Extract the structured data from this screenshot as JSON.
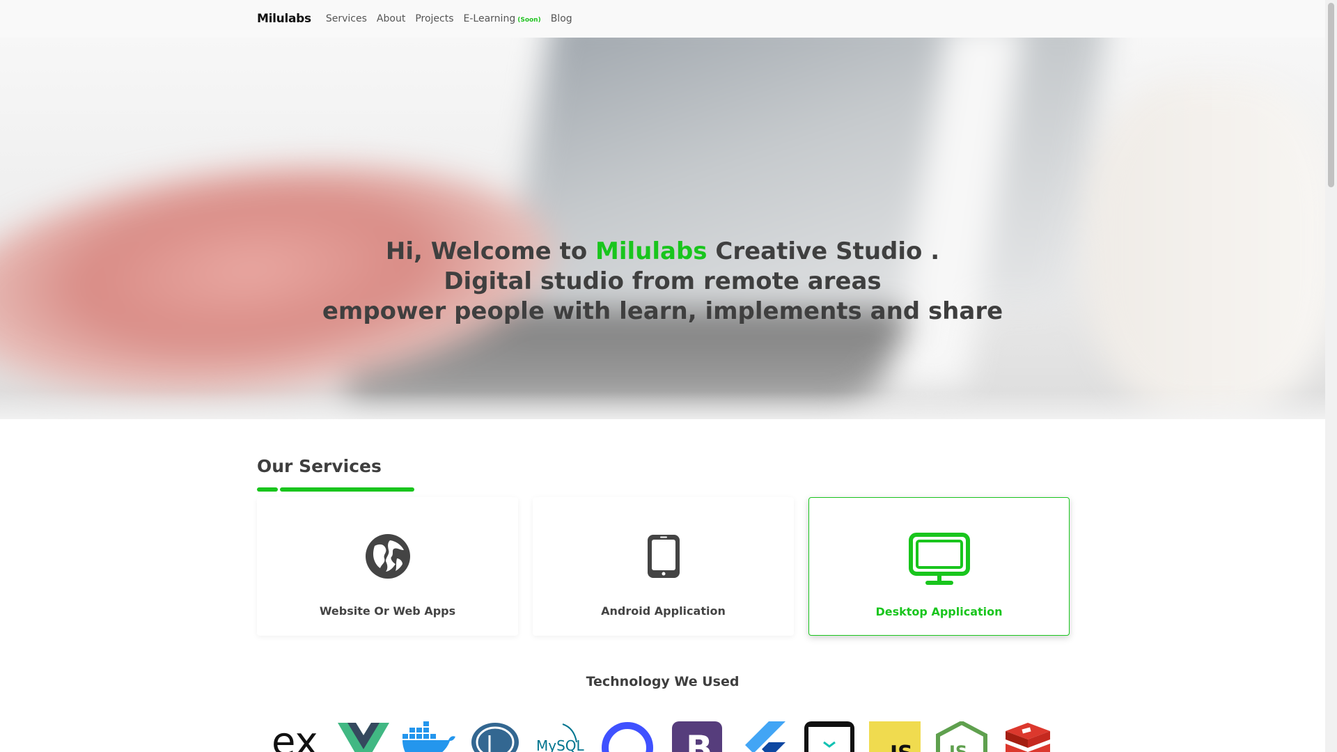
{
  "nav": {
    "brand": "Milulabs",
    "links": [
      "Services",
      "About",
      "Projects",
      "E-Learning",
      "Blog"
    ],
    "soon_badge": "(Soon)"
  },
  "hero": {
    "line1_prefix": "Hi, Welcome to ",
    "line1_brand": "Milulabs",
    "line1_suffix": " Creative Studio .",
    "line2": "Digital studio from remote areas",
    "line3": "empower people with learn, implements and share"
  },
  "services": {
    "title": "Our Services",
    "items": [
      {
        "label": "Website Or Web Apps",
        "icon": "globe-icon"
      },
      {
        "label": "Android Application",
        "icon": "tablet-icon"
      },
      {
        "label": "Desktop Application",
        "icon": "monitor-icon"
      }
    ]
  },
  "technology": {
    "title": "Technology We Used",
    "items": [
      {
        "name": "express-logo",
        "text": "ex"
      },
      {
        "name": "vue-logo"
      },
      {
        "name": "docker-logo"
      },
      {
        "name": "postgresql-logo"
      },
      {
        "name": "mysql-logo",
        "text": "MySQL"
      },
      {
        "name": "circle-logo"
      },
      {
        "name": "bootstrap-logo",
        "text": "B"
      },
      {
        "name": "flutter-logo"
      },
      {
        "name": "phone-logo"
      },
      {
        "name": "javascript-logo",
        "text": "JS"
      },
      {
        "name": "nodejs-logo",
        "text": "JS"
      },
      {
        "name": "redis-logo"
      }
    ]
  },
  "colors": {
    "accent": "#19c51d",
    "text": "#3e3e3e",
    "nav_bg": "#f9f9f9"
  }
}
